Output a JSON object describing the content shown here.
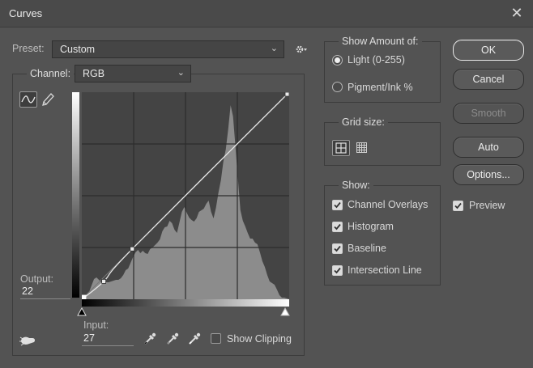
{
  "window": {
    "title": "Curves",
    "close_glyph": "✕"
  },
  "preset": {
    "label": "Preset:",
    "value": "Custom",
    "settings_icon": "gear-icon"
  },
  "channel": {
    "label": "Channel:",
    "value": "RGB"
  },
  "tools": {
    "curve_icon": "curve-edit-icon",
    "pencil_icon": "pencil-icon"
  },
  "output": {
    "label": "Output:",
    "value": "22"
  },
  "input": {
    "label": "Input:",
    "value": "27"
  },
  "eyedroppers": [
    "black-point-eyedropper-icon",
    "gray-point-eyedropper-icon",
    "white-point-eyedropper-icon"
  ],
  "show_clipping": {
    "label": "Show Clipping",
    "checked": false
  },
  "show_amount": {
    "title": "Show Amount of:",
    "options": [
      {
        "label": "Light  (0-255)",
        "selected": true
      },
      {
        "label": "Pigment/Ink %",
        "selected": false
      }
    ]
  },
  "grid_size": {
    "title": "Grid size:",
    "options": [
      "simple-grid-icon",
      "detailed-grid-icon"
    ],
    "selected": 0
  },
  "show": {
    "title": "Show:",
    "items": [
      {
        "label": "Channel Overlays",
        "checked": true
      },
      {
        "label": "Histogram",
        "checked": true
      },
      {
        "label": "Baseline",
        "checked": true
      },
      {
        "label": "Intersection Line",
        "checked": true
      }
    ]
  },
  "buttons": {
    "ok": "OK",
    "cancel": "Cancel",
    "smooth": "Smooth",
    "auto": "Auto",
    "options": "Options..."
  },
  "preview": {
    "label": "Preview",
    "checked": true
  },
  "curve": {
    "points": [
      [
        0,
        0
      ],
      [
        27,
        22
      ],
      [
        62,
        62
      ],
      [
        255,
        255
      ]
    ],
    "histogram": [
      0,
      2,
      4,
      9,
      17,
      25,
      27,
      24,
      21,
      20,
      21,
      21,
      22,
      23,
      24,
      24,
      26,
      30,
      36,
      38,
      45,
      52,
      58,
      61,
      57,
      60,
      57,
      56,
      62,
      64,
      67,
      70,
      74,
      84,
      89,
      90,
      97,
      94,
      86,
      82,
      95,
      108,
      114,
      107,
      101,
      98,
      96,
      100,
      108,
      110,
      112,
      118,
      122,
      108,
      100,
      113,
      132,
      147,
      170,
      185,
      210,
      240,
      226,
      188,
      148,
      110,
      97,
      90,
      82,
      75,
      75,
      70,
      68,
      58,
      47,
      40,
      30,
      22,
      20,
      18,
      12,
      5,
      2,
      2,
      1,
      0
    ]
  }
}
